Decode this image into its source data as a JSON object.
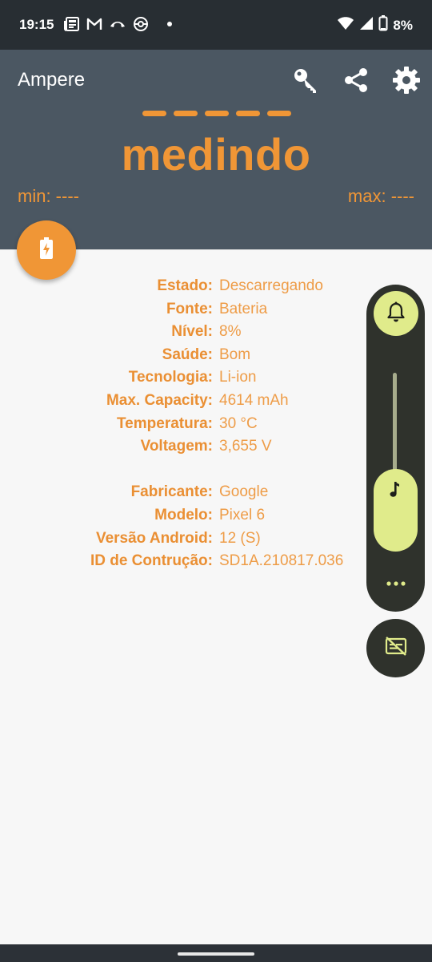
{
  "status_bar": {
    "time": "19:15",
    "left_icons": [
      "newspaper-icon",
      "gmail-icon",
      "call-end-icon",
      "pokeball-icon",
      "dot-icon"
    ],
    "right_icons": [
      "wifi-icon",
      "signal-icon",
      "battery-icon"
    ],
    "battery_text": "8%"
  },
  "header": {
    "app_title": "Ampere",
    "toolbar_icons": [
      "key-icon",
      "share-icon",
      "settings-icon"
    ],
    "measure_placeholder": "-----",
    "measuring_text": "medindo",
    "min_text": "min: ----",
    "max_text": "max: ----"
  },
  "fab": {
    "icon": "battery-charging-icon"
  },
  "battery_info": [
    {
      "label": "Estado:",
      "value": "Descarregando"
    },
    {
      "label": "Fonte:",
      "value": "Bateria"
    },
    {
      "label": "Nível:",
      "value": "8%"
    },
    {
      "label": "Saúde:",
      "value": "Bom"
    },
    {
      "label": "Tecnologia:",
      "value": "Li-ion"
    },
    {
      "label": "Max. Capacity:",
      "value": "4614 mAh"
    },
    {
      "label": "Temperatura:",
      "value": "30 °C"
    },
    {
      "label": "Voltagem:",
      "value": "3,655 V"
    }
  ],
  "device_info": [
    {
      "label": "Fabricante:",
      "value": "Google"
    },
    {
      "label": "Modelo:",
      "value": "Pixel 6"
    },
    {
      "label": "Versão Android:",
      "value": "12 (S)"
    },
    {
      "label": "ID de Contrução:",
      "value": "SD1A.210817.036"
    }
  ],
  "volume_panel": {
    "ringer_icon": "bell-icon",
    "media_icon": "music-note-icon",
    "more_icon": "more-dots-icon",
    "caption_icon": "live-caption-off-icon",
    "media_volume_fraction": 0.3
  },
  "colors": {
    "accent": "#f09636",
    "header_bg": "#4b5762",
    "status_bar_bg": "#282e33",
    "volume_panel_bg": "#2f322c",
    "volume_accent": "#e0eb8b",
    "content_bg": "#f7f7f7"
  }
}
